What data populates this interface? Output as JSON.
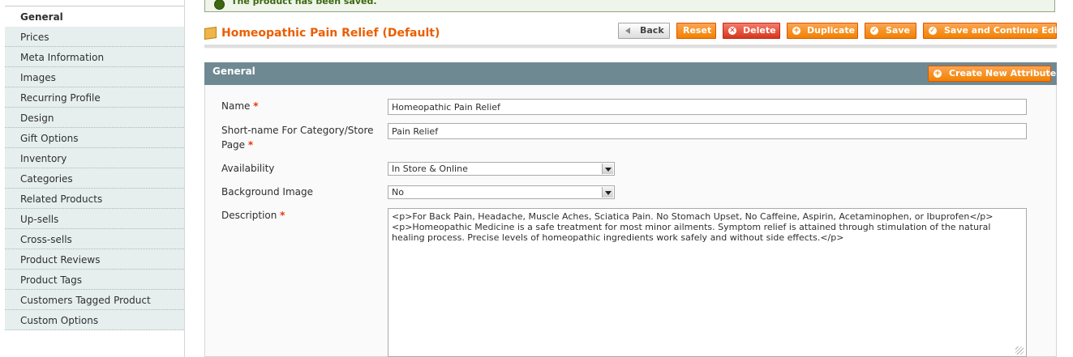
{
  "sidebar": {
    "active_tab": "General",
    "items": [
      "Prices",
      "Meta Information",
      "Images",
      "Recurring Profile",
      "Design",
      "Gift Options",
      "Inventory",
      "Categories",
      "Related Products",
      "Up-sells",
      "Cross-sells",
      "Product Reviews",
      "Product Tags",
      "Customers Tagged Product",
      "Custom Options"
    ]
  },
  "message": {
    "text": "The product has been saved."
  },
  "header": {
    "title": "Homeopathic Pain Relief (Default)",
    "buttons": {
      "back": "Back",
      "reset": "Reset",
      "delete": "Delete",
      "duplicate": "Duplicate",
      "save": "Save",
      "save_continue": "Save and Continue Edit"
    }
  },
  "section": {
    "title": "General",
    "create_attribute": "Create New Attribute"
  },
  "form": {
    "name_label": "Name",
    "name_value": "Homeopathic Pain Relief",
    "shortname_label_1": "Short-name For Category/Store",
    "shortname_label_2": "Page",
    "shortname_value": "Pain Relief",
    "availability_label": "Availability",
    "availability_value": "In Store & Online",
    "background_label": "Background Image",
    "background_value": "No",
    "description_label": "Description",
    "description_value": "<p>For Back Pain, Headache, Muscle Aches, Sciatica Pain. No Stomach Upset, No Caffeine, Aspirin, Acetaminophen, or Ibuprofen</p>\n<p>Homeopathic Medicine is a safe treatment for most minor ailments. Symptom relief is attained through stimulation of the natural healing process. Precise levels of homeopathic ingredients work safely and without side effects.</p>",
    "required_mark": "*"
  }
}
